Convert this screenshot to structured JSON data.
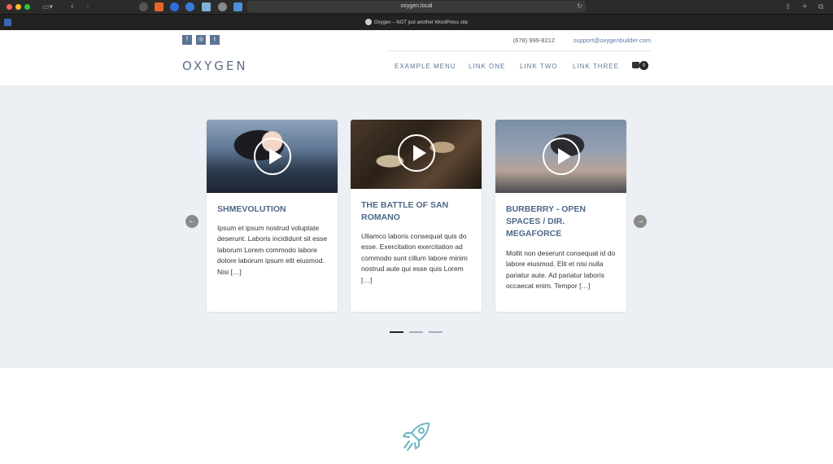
{
  "browser": {
    "url": "oxygen.local",
    "tab_title": "Oxygen – NOT just another WordPress site"
  },
  "topbar": {
    "social": [
      "f",
      "◎",
      "t"
    ],
    "phone": "(678) 999-8212",
    "email": "support@oxygenbuilder.com"
  },
  "header": {
    "logo": "OXYGEN",
    "nav": [
      "EXAMPLE MENU",
      "LINK ONE",
      "LINK TWO",
      "LINK THREE"
    ],
    "cart_count": "0"
  },
  "slider": {
    "prev_label": "←",
    "next_label": "→",
    "cards": [
      {
        "title": "SHMEVOLUTION",
        "text": "Ipsum et ipsum nostrud voluptate deserunt. Laboris incididunt sit esse laborum Lorem commodo labore dolore laborum ipsum elit eiusmod. Nisi […]"
      },
      {
        "title": "THE BATTLE OF SAN ROMANO",
        "text": "Ullamco laboris consequat quis do esse. Exercitation exercitation ad commodo sunt cillum labore minim nostrud aute qui esse quis Lorem […]"
      },
      {
        "title": "BURBERRY - OPEN SPACES / DIR. MEGAFORCE",
        "text": "Mollit non deserunt consequat id do labore eiusmod. Elit et nisi nulla pariatur aute. Ad pariatur laboris occaecat enim. Tempor […]"
      }
    ],
    "pagination": {
      "total": 3,
      "active": 1
    }
  },
  "colors": {
    "accent": "#5b79a6",
    "slider_bg": "#ecf0f4",
    "rocket": "#6bb6c6"
  }
}
